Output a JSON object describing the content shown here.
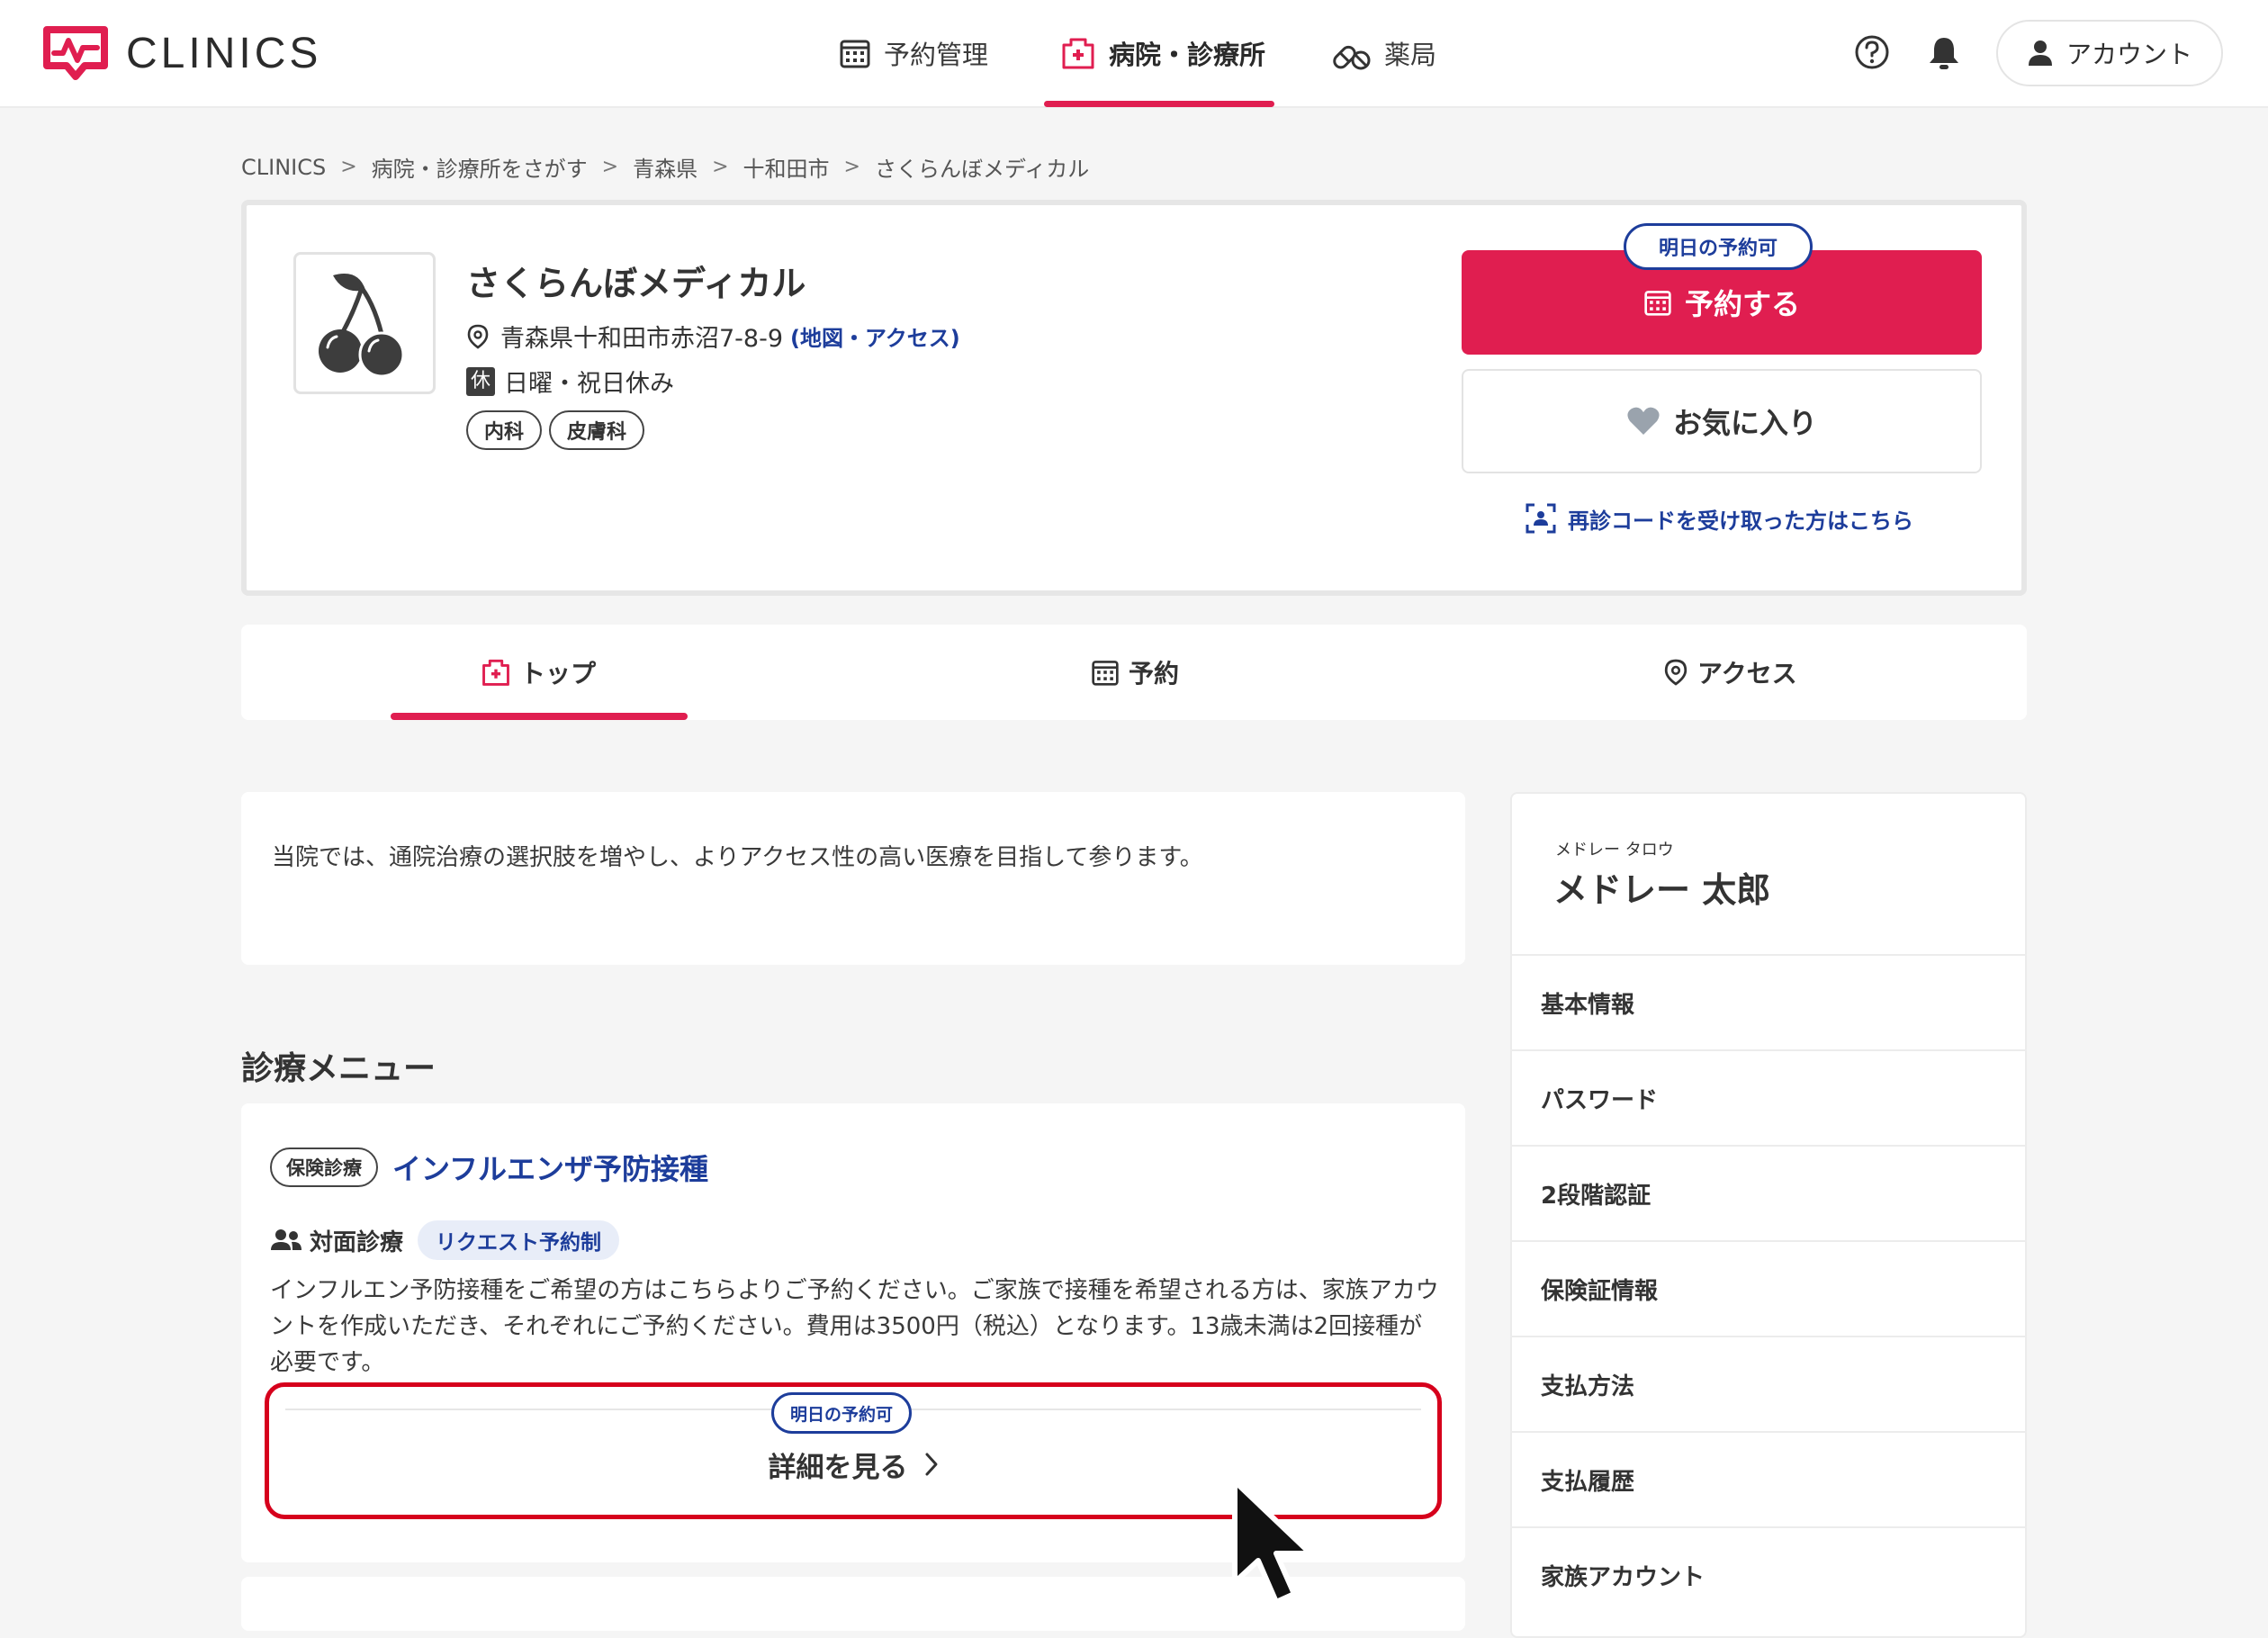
{
  "header": {
    "logo_text": "CLINICS",
    "nav": [
      {
        "label": "予約管理"
      },
      {
        "label": "病院・診療所"
      },
      {
        "label": "薬局"
      }
    ],
    "account_label": "アカウント"
  },
  "breadcrumb": [
    "CLINICS",
    "病院・診療所をさがす",
    "青森県",
    "十和田市",
    "さくらんぼメディカル"
  ],
  "clinic": {
    "name": "さくらんぼメディカル",
    "address": "青森県十和田市赤沼7-8-9",
    "map_link": "(地図・アクセス)",
    "closed_badge": "休",
    "closed_days": "日曜・祝日休み",
    "tags": [
      "内科",
      "皮膚科"
    ],
    "availability_badge": "明日の予約可",
    "reserve_label": "予約する",
    "favorite_label": "お気に入り",
    "revisit_link": "再診コードを受け取った方はこちら"
  },
  "tabs": [
    {
      "label": "トップ"
    },
    {
      "label": "予約"
    },
    {
      "label": "アクセス"
    }
  ],
  "intro_text": "当院では、通院治療の選択肢を増やし、よりアクセス性の高い医療を目指して参ります。",
  "menu": {
    "section_title": "診療メニュー",
    "items": [
      {
        "tag": "保険診療",
        "name": "インフルエンザ予防接種",
        "visit_type": "対面診療",
        "booking_type": "リクエスト予約制",
        "description": "インフルエン予防接種をご希望の方はこちらよりご予約ください。ご家族で接種を希望される方は、家族アカウントを作成いただき、それぞれにご予約ください。費用は3500円（税込）となります。13歳未満は2回接種が必要です。",
        "availability_badge": "明日の予約可",
        "detail_label": "詳細を見る"
      }
    ]
  },
  "side_panel": {
    "user_kana": "メドレー タロウ",
    "user_name": "メドレー 太郎",
    "items": [
      "基本情報",
      "パスワード",
      "2段階認証",
      "保険証情報",
      "支払方法",
      "支払履歴",
      "家族アカウント"
    ]
  },
  "colors": {
    "accent": "#e01e50",
    "link": "#1d3d9b",
    "highlight": "#d6001c"
  }
}
